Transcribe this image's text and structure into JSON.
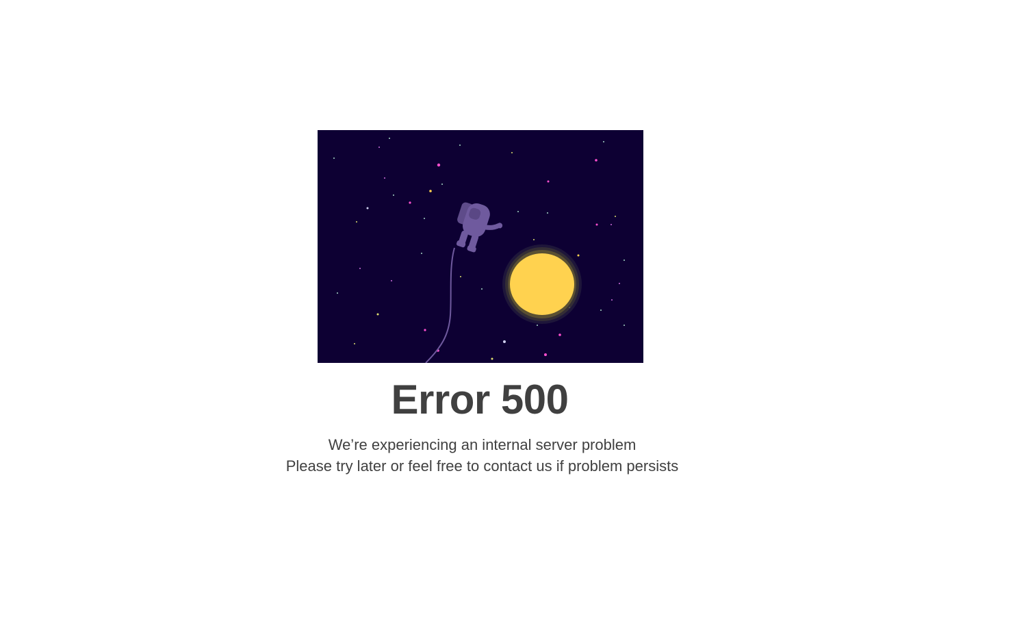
{
  "illustration": {
    "icon": "astronaut-floating-in-space",
    "colors": {
      "space": "#0d0033",
      "astronaut": "#6f5a9e",
      "sun": "#ffd24f",
      "sun_glow": "#8a7a2a"
    }
  },
  "error": {
    "title": "Error 500",
    "line1": "We’re experiencing an internal server problem",
    "line2": "Please try later or feel free to contact us if problem persists"
  }
}
